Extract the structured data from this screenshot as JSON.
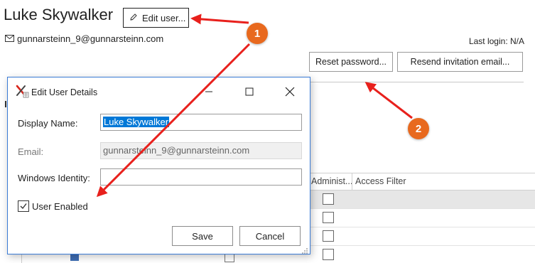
{
  "profile": {
    "name": "Luke Skywalker",
    "edit_button": "Edit user...",
    "email": "gunnarsteinn_9@gunnarsteinn.com",
    "last_login": "Last login: N/A",
    "reset_password_button": "Reset password...",
    "resend_invitation_button": "Resend invitation email..."
  },
  "grid": {
    "columns": [
      "Administ...",
      "Access Filter"
    ],
    "rows": [
      {
        "admin": false,
        "selected": true
      },
      {
        "admin": false,
        "selected": false
      },
      {
        "admin": false,
        "selected": false
      },
      {
        "admin": false,
        "selected": false
      }
    ]
  },
  "dialog": {
    "title": "Edit User Details",
    "display_name_label": "Display Name:",
    "display_name_value": "Luke Skywalker",
    "email_label": "Email:",
    "email_value": "gunnarsteinn_9@gunnarsteinn.com",
    "windows_identity_label": "Windows Identity:",
    "windows_identity_value": "",
    "user_enabled_label": "User Enabled",
    "user_enabled": true,
    "save_button": "Save",
    "cancel_button": "Cancel"
  },
  "annotations": {
    "callout_1": "1",
    "callout_2": "2",
    "arrow_color": "#e8201c",
    "callout_color": "#e8691e"
  },
  "icons": [
    "pencil-icon",
    "envelope-icon",
    "app-x-icon",
    "minimize-icon",
    "maximize-icon",
    "close-icon",
    "checkmark-icon",
    "resize-grip-icon"
  ]
}
